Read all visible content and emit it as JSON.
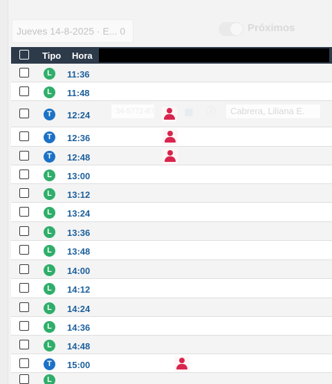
{
  "toolbar": {
    "date_value": "Jueves 14-8-2025 · E... 0",
    "toggle_label": "Próximos"
  },
  "table": {
    "headers": {
      "tipo": "Tipo",
      "hora": "Hora"
    },
    "rows": [
      {
        "type": "L",
        "time": "11:36",
        "patient": false
      },
      {
        "type": "L",
        "time": "11:48",
        "patient": false
      },
      {
        "type": "T",
        "time": "12:24",
        "patient": true,
        "phone": "34-5772-878",
        "name": "Cabrera, Liliana E."
      },
      {
        "type": "T",
        "time": "12:36",
        "patient": true
      },
      {
        "type": "T",
        "time": "12:48",
        "patient": true
      },
      {
        "type": "L",
        "time": "13:00",
        "patient": false
      },
      {
        "type": "L",
        "time": "13:12",
        "patient": false
      },
      {
        "type": "L",
        "time": "13:24",
        "patient": false
      },
      {
        "type": "L",
        "time": "13:36",
        "patient": false
      },
      {
        "type": "L",
        "time": "13:48",
        "patient": false
      },
      {
        "type": "L",
        "time": "14:00",
        "patient": false
      },
      {
        "type": "L",
        "time": "14:12",
        "patient": false
      },
      {
        "type": "L",
        "time": "14:24",
        "patient": false
      },
      {
        "type": "L",
        "time": "14:36",
        "patient": false
      },
      {
        "type": "L",
        "time": "14:48",
        "patient": false
      },
      {
        "type": "T",
        "time": "15:00",
        "patient": true
      },
      {
        "type": "L",
        "time": "",
        "patient": false
      }
    ]
  },
  "icons": {
    "checkbox": "checkbox-icon",
    "patient": "person-icon",
    "calendar": "calendar-icon",
    "info": "info-icon"
  },
  "colors": {
    "header_bg": "#2d3a4a",
    "badge_L": "#2fae6a",
    "badge_T": "#1c72c6",
    "time": "#1c5f9c",
    "person": "#d8254f"
  }
}
